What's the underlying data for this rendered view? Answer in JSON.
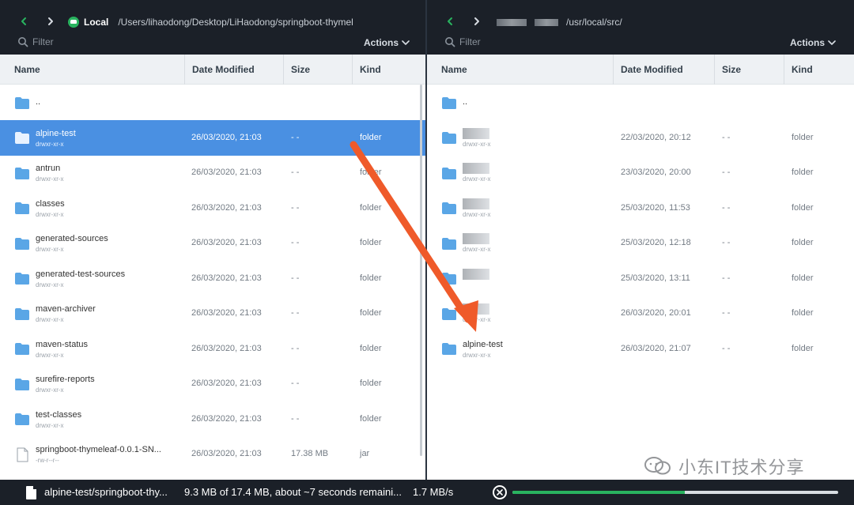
{
  "left": {
    "location_name": "Local",
    "path": "/Users/lihaodong/Desktop/LiHaodong/springboot-thymel",
    "filter_placeholder": "Filter",
    "actions_label": "Actions",
    "columns": {
      "name": "Name",
      "date": "Date Modified",
      "size": "Size",
      "kind": "Kind"
    },
    "rows": [
      {
        "name": "..",
        "perm": "",
        "date": "",
        "size": "",
        "kind": "",
        "icon": "folder-icon",
        "selected": false
      },
      {
        "name": "alpine-test",
        "perm": "drwxr-xr-x",
        "date": "26/03/2020, 21:03",
        "size": "- -",
        "kind": "folder",
        "icon": "folder-icon",
        "selected": true
      },
      {
        "name": "antrun",
        "perm": "drwxr-xr-x",
        "date": "26/03/2020, 21:03",
        "size": "- -",
        "kind": "folder",
        "icon": "folder-icon",
        "selected": false
      },
      {
        "name": "classes",
        "perm": "drwxr-xr-x",
        "date": "26/03/2020, 21:03",
        "size": "- -",
        "kind": "folder",
        "icon": "folder-icon",
        "selected": false
      },
      {
        "name": "generated-sources",
        "perm": "drwxr-xr-x",
        "date": "26/03/2020, 21:03",
        "size": "- -",
        "kind": "folder",
        "icon": "folder-icon",
        "selected": false
      },
      {
        "name": "generated-test-sources",
        "perm": "drwxr-xr-x",
        "date": "26/03/2020, 21:03",
        "size": "- -",
        "kind": "folder",
        "icon": "folder-icon",
        "selected": false
      },
      {
        "name": "maven-archiver",
        "perm": "drwxr-xr-x",
        "date": "26/03/2020, 21:03",
        "size": "- -",
        "kind": "folder",
        "icon": "folder-icon",
        "selected": false
      },
      {
        "name": "maven-status",
        "perm": "drwxr-xr-x",
        "date": "26/03/2020, 21:03",
        "size": "- -",
        "kind": "folder",
        "icon": "folder-icon",
        "selected": false
      },
      {
        "name": "surefire-reports",
        "perm": "drwxr-xr-x",
        "date": "26/03/2020, 21:03",
        "size": "- -",
        "kind": "folder",
        "icon": "folder-icon",
        "selected": false
      },
      {
        "name": "test-classes",
        "perm": "drwxr-xr-x",
        "date": "26/03/2020, 21:03",
        "size": "- -",
        "kind": "folder",
        "icon": "folder-icon",
        "selected": false
      },
      {
        "name": "springboot-thymeleaf-0.0.1-SN...",
        "perm": "-rw-r--r--",
        "date": "26/03/2020, 21:03",
        "size": "17.38 MB",
        "kind": "jar",
        "icon": "file-icon",
        "selected": false
      }
    ]
  },
  "right": {
    "path": "/usr/local/src/",
    "filter_placeholder": "Filter",
    "actions_label": "Actions",
    "columns": {
      "name": "Name",
      "date": "Date Modified",
      "size": "Size",
      "kind": "Kind"
    },
    "rows": [
      {
        "name": "..",
        "perm": "",
        "date": "",
        "size": "",
        "kind": "",
        "icon": "folder-icon",
        "selected": false,
        "redacted": false
      },
      {
        "name": "",
        "perm": "drwxr-xr-x",
        "date": "22/03/2020, 20:12",
        "size": "- -",
        "kind": "folder",
        "icon": "folder-icon",
        "selected": false,
        "redacted": true
      },
      {
        "name": "",
        "perm": "drwxr-xr-x",
        "date": "23/03/2020, 20:00",
        "size": "- -",
        "kind": "folder",
        "icon": "folder-icon",
        "selected": false,
        "redacted": true
      },
      {
        "name": "",
        "perm": "drwxr-xr-x",
        "date": "25/03/2020, 11:53",
        "size": "- -",
        "kind": "folder",
        "icon": "folder-icon",
        "selected": false,
        "redacted": true
      },
      {
        "name": "",
        "perm": "drwxr-xr-x",
        "date": "25/03/2020, 12:18",
        "size": "- -",
        "kind": "folder",
        "icon": "folder-icon",
        "selected": false,
        "redacted": true
      },
      {
        "name": "",
        "perm": "",
        "date": "25/03/2020, 13:11",
        "size": "- -",
        "kind": "folder",
        "icon": "folder-icon",
        "selected": false,
        "redacted": true
      },
      {
        "name": "",
        "perm": "drwxr-xr-x",
        "date": "26/03/2020, 20:01",
        "size": "- -",
        "kind": "folder",
        "icon": "folder-icon",
        "selected": false,
        "redacted": true
      },
      {
        "name": "alpine-test",
        "perm": "drwxr-xr-x",
        "date": "26/03/2020, 21:07",
        "size": "- -",
        "kind": "folder",
        "icon": "folder-icon",
        "selected": false,
        "redacted": false
      }
    ]
  },
  "statusbar": {
    "filename": "alpine-test/springboot-thy...",
    "progress_text": "9.3 MB of 17.4 MB, about ~7 seconds remaini...",
    "speed": "1.7 MB/s",
    "progress_fraction": 0.53
  },
  "watermark": {
    "text": "小东IT技术分享",
    "icon": "wechat-icon"
  },
  "colors": {
    "toolbar_bg": "#1b2028",
    "selection": "#4a90e2",
    "folder": "#5aa6e6",
    "accent_green": "#29b35f",
    "arrow": "#ef5a2a"
  }
}
